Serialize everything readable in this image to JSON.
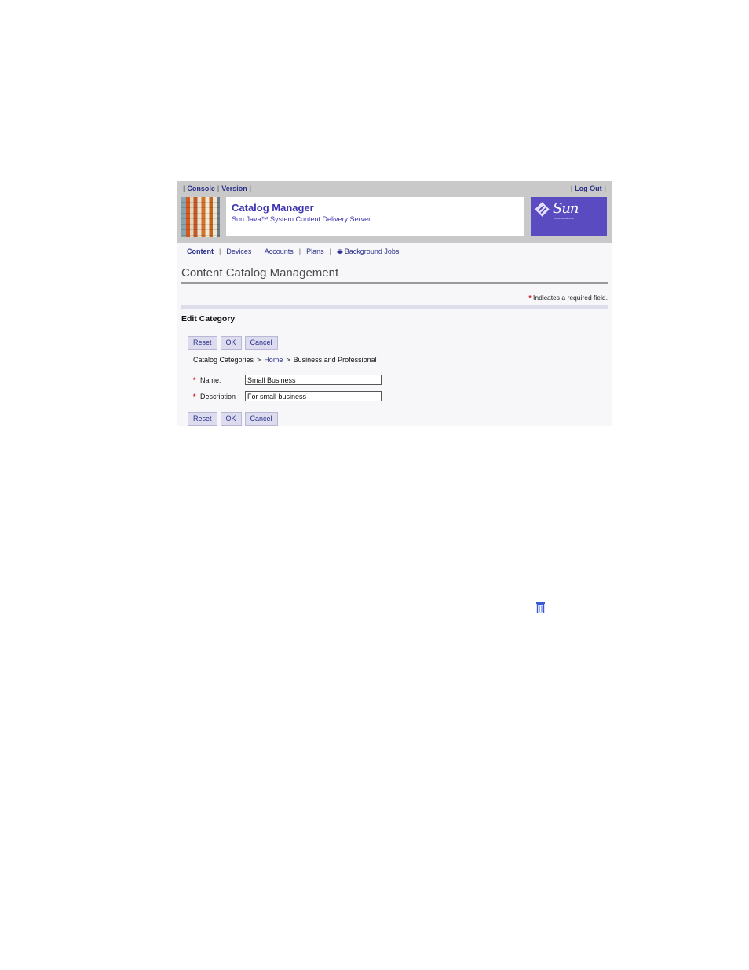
{
  "topbar": {
    "left_links": [
      "Console",
      "Version"
    ],
    "right_links": [
      "Log Out"
    ]
  },
  "banner": {
    "app_title": "Catalog Manager",
    "app_subtitle": "Sun Java™ System Content Delivery Server",
    "logo_text": "Sun",
    "logo_subtext": "microsystems"
  },
  "tabs": [
    "Content",
    "Devices",
    "Accounts",
    "Plans",
    "Background Jobs"
  ],
  "active_tab": "Content",
  "page_title": "Content Catalog Management",
  "required_note": {
    "star": "*",
    "text": " Indicates a required field."
  },
  "section_title": "Edit Category",
  "buttons": {
    "reset": "Reset",
    "ok": "OK",
    "cancel": "Cancel"
  },
  "breadcrumb": {
    "root": "Catalog Categories",
    "separator": ">",
    "home": "Home",
    "current": "Business and Professional"
  },
  "form": {
    "name_label": "Name:",
    "name_value": "Small Business",
    "description_label": "Description",
    "description_value": "For small business",
    "required_marker": "*"
  },
  "colors": {
    "accent": "#3b33b0",
    "logo_bg": "#5a4cc0",
    "required": "#c41e1e",
    "button_bg": "#dcdcee"
  },
  "icons": {
    "background_jobs": "globe-icon",
    "floating": "trash-icon"
  }
}
